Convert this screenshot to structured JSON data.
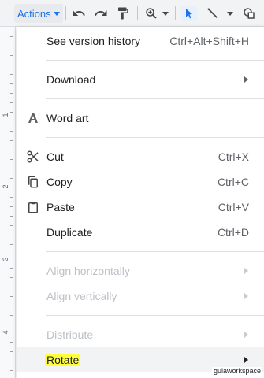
{
  "toolbar": {
    "actions_label": "Actions",
    "accent": "#1a73e8",
    "icons": [
      "undo-icon",
      "redo-icon",
      "paint-format-icon",
      "zoom-icon",
      "select-icon",
      "line-icon",
      "shape-icon"
    ]
  },
  "ruler": {
    "numbers": [
      "1",
      "2",
      "3",
      "4"
    ]
  },
  "menu": {
    "version_history": {
      "label": "See version history",
      "shortcut": "Ctrl+Alt+Shift+H"
    },
    "download": {
      "label": "Download"
    },
    "word_art": {
      "label": "Word art",
      "icon": "word-art-icon"
    },
    "cut": {
      "label": "Cut",
      "shortcut": "Ctrl+X",
      "icon": "scissors-icon"
    },
    "copy": {
      "label": "Copy",
      "shortcut": "Ctrl+C",
      "icon": "copy-icon"
    },
    "paste": {
      "label": "Paste",
      "shortcut": "Ctrl+V",
      "icon": "clipboard-icon"
    },
    "duplicate": {
      "label": "Duplicate",
      "shortcut": "Ctrl+D"
    },
    "align_horizontally": {
      "label": "Align horizontally",
      "disabled": true
    },
    "align_vertically": {
      "label": "Align vertically",
      "disabled": true
    },
    "distribute": {
      "label": "Distribute",
      "disabled": true
    },
    "rotate": {
      "label": "Rotate",
      "highlight_color": "#ffff3a"
    }
  },
  "watermark": "guiaworkspace"
}
